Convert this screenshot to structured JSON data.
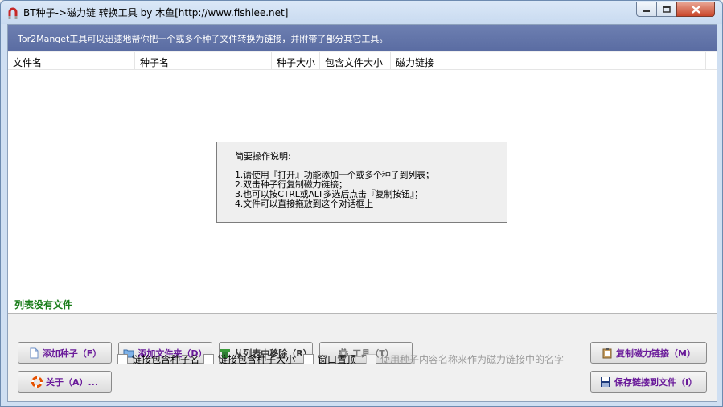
{
  "window": {
    "title": "BT种子->磁力链 转换工具 by 木鱼[http://www.fishlee.net]"
  },
  "banner": {
    "text": "Tor2Manget工具可以迅速地帮你把一个或多个种子文件转换为链接，并附带了部分其它工具。"
  },
  "list": {
    "columns": [
      "文件名",
      "种子名",
      "种子大小",
      "包含文件大小",
      "磁力链接"
    ]
  },
  "help": {
    "title": "简要操作说明:",
    "lines": [
      "1.请使用『打开』功能添加一个或多个种子到列表；",
      "2.双击种子行复制磁力链接；",
      "3.也可以按CTRL或ALT多选后点击『复制按钮』；",
      "4.文件可以直接拖放到这个对话框上"
    ]
  },
  "status": {
    "text": "列表没有文件"
  },
  "buttons": {
    "add_torrent": "添加种子（F）",
    "add_folder": "添加文件夹（D）",
    "remove": "从列表中移除（R）",
    "tools": "工具（T）",
    "copy_magnet": "复制磁力链接（M）",
    "about": "关于（A）...",
    "save_links": "保存链接到文件（I）"
  },
  "options": {
    "include_name": "链接包含种子名",
    "include_size": "链接包含种子大小",
    "always_on_top": "窗口置顶",
    "use_content_name": "使用种子内容名称来作为磁力链接中的名字"
  },
  "colors": {
    "banner": "#5f71a6",
    "status_text": "#1a7d1a",
    "accent_purple": "#6a1b9a"
  },
  "icons": {
    "app": "magnet-icon",
    "add_torrent": "document-icon",
    "add_folder": "folder-icon",
    "remove": "remove-icon",
    "tools": "gear-icon",
    "copy": "clipboard-icon",
    "about": "lifebuoy-icon",
    "save": "floppy-disk-icon"
  }
}
